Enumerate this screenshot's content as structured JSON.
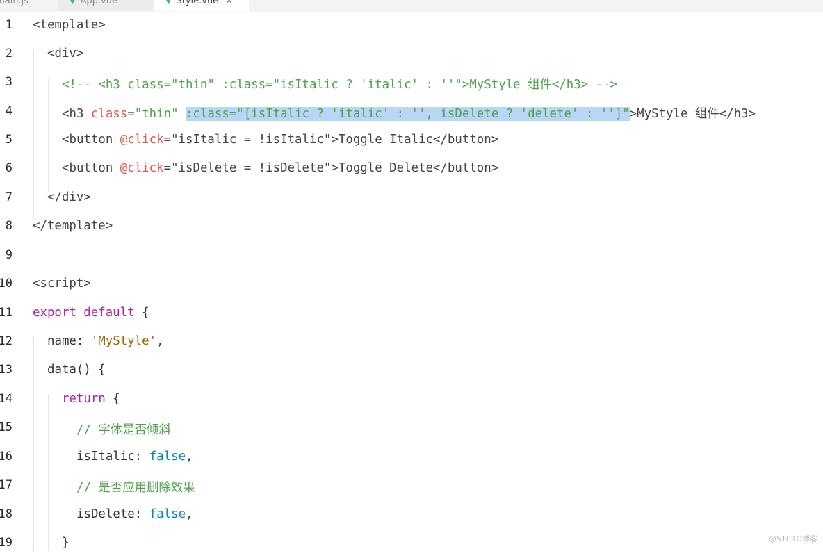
{
  "tabs": [
    {
      "label": "main.js"
    },
    {
      "label": "App.vue",
      "icon": "vue-icon"
    },
    {
      "label": "Style.vue",
      "icon": "vue-icon",
      "active": true,
      "close": "×"
    }
  ],
  "editor": {
    "lines": [
      {
        "n": "1",
        "segs": [
          "<template>"
        ]
      },
      {
        "n": "2",
        "segs": [
          "<div>"
        ]
      },
      {
        "n": "3",
        "segs": [
          "<!-- <h3 class=\"thin\" :class=\"isItalic ? 'italic' : ''\">MyStyle 组件</h3> -->"
        ]
      },
      {
        "n": "4",
        "segs": [
          "<h3 ",
          "class",
          "=\"thin\" ",
          ":class=\"[isItalic ? 'italic' : '', isDelete ? 'delete' : '']\"",
          ">MyStyle 组件</h3>"
        ]
      },
      {
        "n": "5",
        "segs": [
          "<button ",
          "@click",
          "=\"isItalic = !isItalic\">Toggle Italic</button>"
        ]
      },
      {
        "n": "6",
        "segs": [
          "<button ",
          "@click",
          "=\"isDelete = !isDelete\">Toggle Delete</button>"
        ]
      },
      {
        "n": "7",
        "segs": [
          "</div>"
        ]
      },
      {
        "n": "8",
        "segs": [
          "</template>"
        ]
      },
      {
        "n": "9",
        "segs": [
          ""
        ]
      },
      {
        "n": "10",
        "segs": [
          "<script>"
        ]
      },
      {
        "n": "11",
        "segs": [
          "export default ",
          "{"
        ]
      },
      {
        "n": "12",
        "segs": [
          "name: ",
          "'MyStyle'",
          ","
        ]
      },
      {
        "n": "13",
        "segs": [
          "data() {"
        ]
      },
      {
        "n": "14",
        "segs": [
          "return ",
          "{"
        ]
      },
      {
        "n": "15",
        "segs": [
          "// 字体是否倾斜"
        ]
      },
      {
        "n": "16",
        "segs": [
          "isItalic: ",
          "false",
          ","
        ]
      },
      {
        "n": "17",
        "segs": [
          "// 是否应用删除效果"
        ]
      },
      {
        "n": "18",
        "segs": [
          "isDelete: ",
          "false",
          ","
        ]
      },
      {
        "n": "19",
        "segs": [
          "}"
        ]
      }
    ]
  },
  "watermark": "@51CTO博客",
  "colors": {
    "selection": "#b8d7f7",
    "keyword": "#a626a4",
    "string": "#50a14f",
    "attribute": "#e45649",
    "boolean": "#0184bc"
  }
}
